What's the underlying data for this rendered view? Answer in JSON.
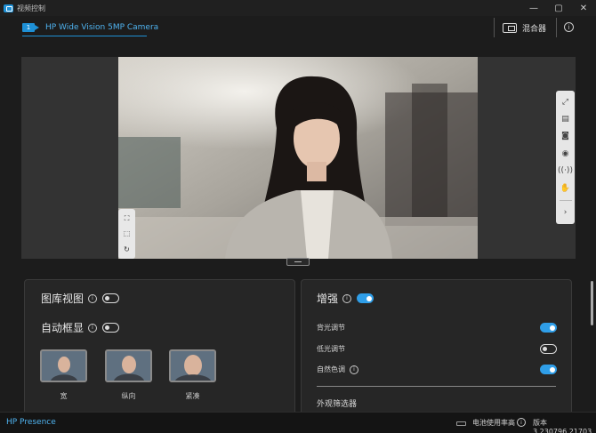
{
  "window": {
    "title": "视频控制",
    "controls": [
      "—",
      "▢",
      "✕"
    ]
  },
  "header": {
    "camera_index": "1",
    "camera_name": "HP Wide Vision 5MP Camera",
    "mix_label": "混合器",
    "info_icon": "i"
  },
  "preview": {
    "left_tools": [
      "frame-select-icon",
      "frame-resize-icon",
      "rotate-icon"
    ],
    "right_tools": [
      "expand-icon",
      "print-icon",
      "camera-icon",
      "record-icon",
      "broadcast-icon",
      "hand-icon",
      "chevron-right-icon"
    ]
  },
  "gallery": {
    "gallery_view_label": "图库视图",
    "gallery_view_on": false,
    "auto_frame_label": "自动框显",
    "auto_frame_on": false,
    "thumbnails": [
      {
        "label": "宽"
      },
      {
        "label": "纵向"
      },
      {
        "label": "紧凑"
      }
    ]
  },
  "enhance": {
    "title": "增强",
    "on": true,
    "options": [
      {
        "label": "背光调节",
        "has_info": false,
        "on": true
      },
      {
        "label": "低光调节",
        "has_info": false,
        "on": false
      },
      {
        "label": "自然色调",
        "has_info": true,
        "on": true
      }
    ],
    "filter_section_label": "外观筛选器"
  },
  "status": {
    "brand": "HP Presence",
    "battery_text": "电池使用率高",
    "version": "版本 3.230796.21703"
  },
  "colors": {
    "accent": "#1e90d6",
    "background": "#1c1c1c"
  }
}
